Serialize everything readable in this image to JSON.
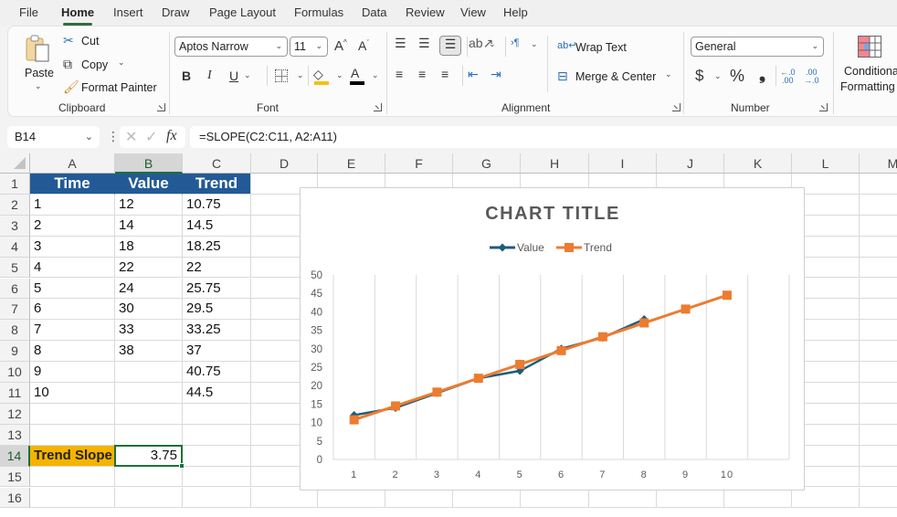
{
  "menu": {
    "tabs": [
      "File",
      "Home",
      "Insert",
      "Draw",
      "Page Layout",
      "Formulas",
      "Data",
      "Review",
      "View",
      "Help"
    ],
    "active": "Home"
  },
  "ribbon": {
    "clipboard": {
      "paste": "Paste",
      "cut": "Cut",
      "copy": "Copy",
      "format_painter": "Format Painter",
      "label": "Clipboard"
    },
    "font": {
      "font_name": "Aptos Narrow",
      "font_size": "11",
      "bold": "B",
      "italic": "I",
      "underline": "U",
      "label": "Font",
      "highlight_color": "#f4c20d",
      "font_color": "#000000"
    },
    "alignment": {
      "wrap_text": "Wrap Text",
      "merge_center": "Merge & Center",
      "label": "Alignment"
    },
    "number": {
      "format": "General",
      "currency": "$",
      "percent": "%",
      "comma": "9",
      "label": "Number"
    },
    "styles": {
      "conditional_formatting_line1": "Conditional",
      "conditional_formatting_line2": "Formatting"
    }
  },
  "formula_bar": {
    "name_box": "B14",
    "fx": "fx",
    "formula": "=SLOPE(C2:C11, A2:A11)"
  },
  "sheet": {
    "columns": [
      "A",
      "B",
      "C",
      "D",
      "E",
      "F",
      "G",
      "H",
      "I",
      "J",
      "K",
      "L",
      "M"
    ],
    "selected_column": "B",
    "rows": [
      "1",
      "2",
      "3",
      "4",
      "5",
      "6",
      "7",
      "8",
      "9",
      "10",
      "11",
      "12",
      "13",
      "14",
      "15",
      "16"
    ],
    "selected_row": "14",
    "headers": [
      "Time",
      "Value",
      "Trend"
    ],
    "data": [
      [
        "1",
        "12",
        "10.75"
      ],
      [
        "2",
        "14",
        "14.5"
      ],
      [
        "3",
        "18",
        "18.25"
      ],
      [
        "4",
        "22",
        "22"
      ],
      [
        "5",
        "24",
        "25.75"
      ],
      [
        "6",
        "30",
        "29.5"
      ],
      [
        "7",
        "33",
        "33.25"
      ],
      [
        "8",
        "38",
        "37"
      ],
      [
        "9",
        "",
        "40.75"
      ],
      [
        "10",
        "",
        "44.5"
      ]
    ],
    "slope_label": "Trend Slope",
    "slope_value": "3.75",
    "header_fill": "#235a96",
    "label_fill": "#f4b400"
  },
  "chart_data": {
    "type": "line",
    "title": "CHART TITLE",
    "xlabel": "",
    "ylabel": "",
    "categories": [
      "1",
      "2",
      "3",
      "4",
      "5",
      "6",
      "7",
      "8",
      "9",
      "10"
    ],
    "ylim": [
      0,
      50
    ],
    "yticks": [
      0,
      5,
      10,
      15,
      20,
      25,
      30,
      35,
      40,
      45,
      50
    ],
    "grid": "vertical",
    "legend": "top-center",
    "series": [
      {
        "name": "Value",
        "color": "#1f5c7a",
        "marker": "diamond",
        "values": [
          12,
          14,
          18,
          22,
          24,
          30,
          33,
          38,
          null,
          null
        ]
      },
      {
        "name": "Trend",
        "color": "#ec7c30",
        "marker": "square",
        "values": [
          10.75,
          14.5,
          18.25,
          22,
          25.75,
          29.5,
          33.25,
          37,
          40.75,
          44.5
        ]
      }
    ]
  }
}
